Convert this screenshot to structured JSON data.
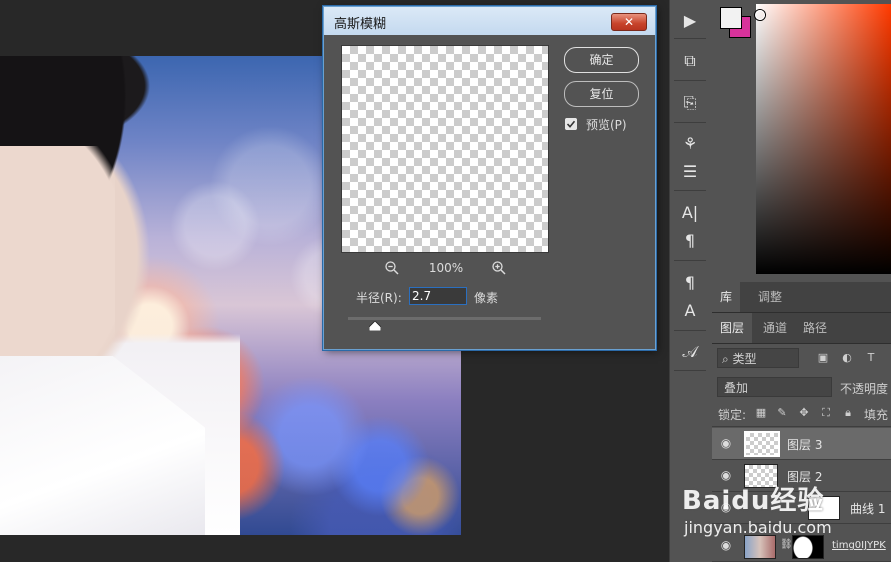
{
  "dialog": {
    "title": "高斯模糊",
    "close_glyph": "✕",
    "ok_label": "确定",
    "reset_label": "复位",
    "preview_label": "预览(P)",
    "preview_checked": true,
    "zoom_level": "100%",
    "radius_label": "半径(R):",
    "radius_value": "2.7",
    "radius_unit": "像素",
    "radius_slider_fraction": 0.11
  },
  "tools": [
    {
      "icon": "play-icon",
      "glyph": "▶"
    },
    {
      "icon": "3d-object-icon",
      "glyph": "⧉"
    },
    {
      "icon": "clone-source-icon",
      "glyph": "⎘"
    },
    {
      "icon": "brush-presets-icon",
      "glyph": "⚘"
    },
    {
      "icon": "properties-sliders-icon",
      "glyph": "☰"
    },
    {
      "icon": "character-icon",
      "glyph": "A|"
    },
    {
      "icon": "paragraph-icon",
      "glyph": "¶"
    },
    {
      "icon": "paragraph-styles-icon",
      "glyph": "¶"
    },
    {
      "icon": "character-styles-icon",
      "glyph": "A"
    },
    {
      "icon": "glyphs-icon",
      "glyph": "𝒜"
    }
  ],
  "panels": {
    "library_tab": "库",
    "adjustments_tab": "调整",
    "layers_tab": "图层",
    "channels_tab": "通道",
    "paths_tab": "路径",
    "filter_kind": "类型",
    "blend_mode": "叠加",
    "opacity_label": "不透明度",
    "lock_label": "锁定:",
    "fill_label": "填充"
  },
  "layers": [
    {
      "name": "图层 3",
      "selected": true
    },
    {
      "name": "图层 2",
      "selected": false
    },
    {
      "name": "曲线 1",
      "selected": false
    },
    {
      "name": "timg0IJYPK",
      "selected": false
    }
  ],
  "colors": {
    "foreground": "#f2f2f2",
    "background": "#d8329b",
    "accent": "#2a6fc0"
  },
  "watermark": {
    "logo": "Baidu经验",
    "url": "jingyan.baidu.com"
  }
}
